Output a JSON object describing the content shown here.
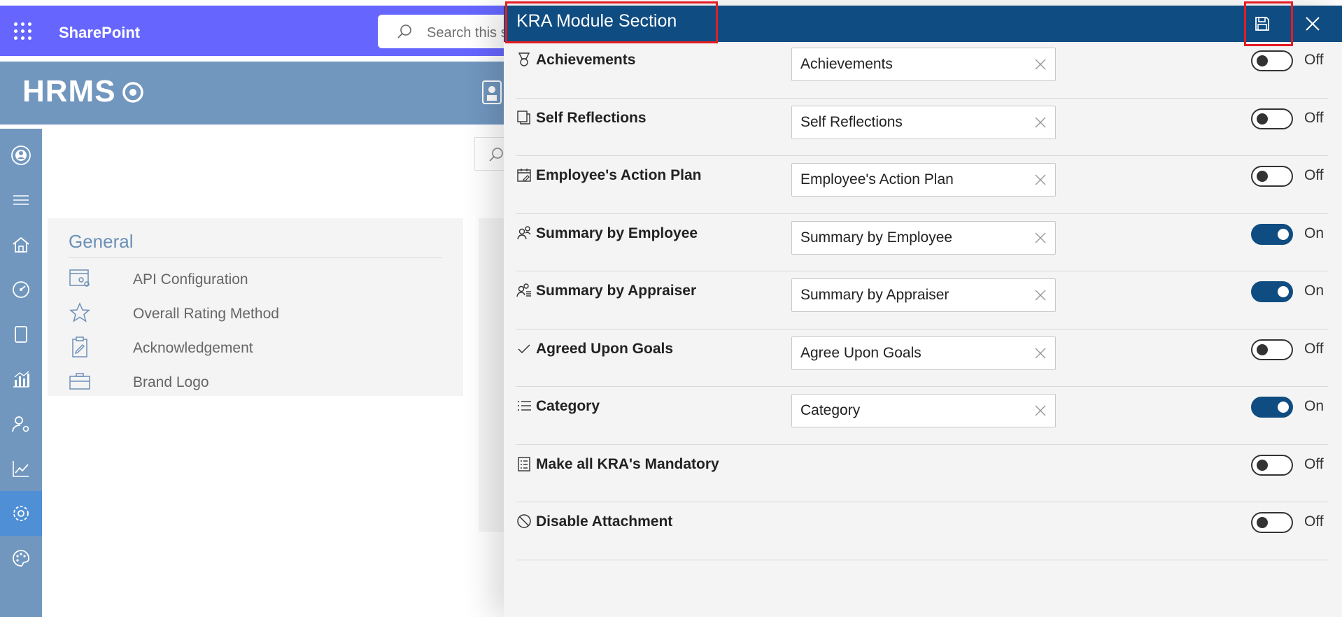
{
  "suite_bar": {
    "app_name": "SharePoint",
    "search_placeholder": "Search this site"
  },
  "brand": {
    "logo_text": "HRMS"
  },
  "left_rail": {
    "items": [
      {
        "icon": "profile-circle-icon"
      },
      {
        "icon": "menu-icon"
      },
      {
        "icon": "home-icon"
      },
      {
        "icon": "dashboard-gauge-icon"
      },
      {
        "icon": "document-icon"
      },
      {
        "icon": "analytics-chart-icon"
      },
      {
        "icon": "user-settings-icon"
      },
      {
        "icon": "trend-line-icon"
      },
      {
        "icon": "settings-gear-icon",
        "active": true
      },
      {
        "icon": "palette-icon"
      }
    ]
  },
  "general_card": {
    "title": "General",
    "items": [
      {
        "label": "API Configuration",
        "icon": "api-config-icon"
      },
      {
        "label": "Overall Rating Method",
        "icon": "star-icon"
      },
      {
        "label": "Acknowledgement",
        "icon": "clipboard-edit-icon"
      },
      {
        "label": "Brand Logo",
        "icon": "briefcase-icon"
      }
    ]
  },
  "panel": {
    "title": "KRA Module Section",
    "save_icon": "save-icon",
    "close_icon": "close-icon",
    "on_label": "On",
    "off_label": "Off",
    "rows": [
      {
        "label": "Achievements",
        "icon": "ribbon-medal-icon",
        "value": "Achievements",
        "state": "Off"
      },
      {
        "label": "Self Reflections",
        "icon": "copy-pages-icon",
        "value": "Self Reflections",
        "state": "Off"
      },
      {
        "label": "Employee's Action Plan",
        "icon": "calendar-edit-icon",
        "value": "Employee's Action Plan",
        "state": "Off"
      },
      {
        "label": "Summary by Employee",
        "icon": "people-icon",
        "value": "Summary by Employee",
        "state": "On"
      },
      {
        "label": "Summary by Appraiser",
        "icon": "people-list-icon",
        "value": "Summary by Appraiser",
        "state": "On"
      },
      {
        "label": "Agreed Upon Goals",
        "icon": "checkmark-icon",
        "value": "Agree Upon Goals",
        "state": "Off"
      },
      {
        "label": "Category",
        "icon": "bulleted-list-icon",
        "value": "Category",
        "state": "On"
      },
      {
        "label": "Make all KRA's Mandatory",
        "icon": "checklist-doc-icon",
        "state": "Off"
      },
      {
        "label": "Disable Attachment",
        "icon": "block-icon",
        "state": "Off"
      }
    ]
  },
  "colors": {
    "suite_bar": "#6666ff",
    "panel_header": "#0f4c81",
    "toggle_on": "#0f4c81",
    "rail": "#7197bf",
    "highlight": "#e51c23"
  }
}
